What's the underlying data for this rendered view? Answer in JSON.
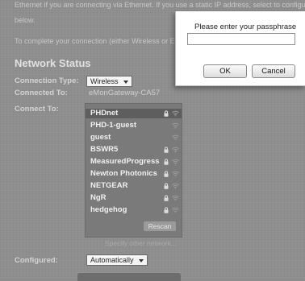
{
  "intro": {
    "line1": "Ethernet if you are connecting via Ethernet. If you use a static IP address, select to configure",
    "line2": "below.",
    "line3": "To complete your connection (either Wireless or E"
  },
  "network_status": {
    "title": "Network Status",
    "connection_type_label": "Connection Type:",
    "connection_type_value": "Wireless",
    "connected_to_label": "Connected To:",
    "connected_to_value": "eMonGateway-CA57",
    "connect_to_label": "Connect To:",
    "networks": [
      {
        "name": "PHDnet",
        "locked": true,
        "selected": true
      },
      {
        "name": "PHD-1-guest",
        "locked": false,
        "selected": false
      },
      {
        "name": "guest",
        "locked": false,
        "selected": false
      },
      {
        "name": "BSWR5",
        "locked": true,
        "selected": false
      },
      {
        "name": "MeasuredProgress",
        "locked": true,
        "selected": false
      },
      {
        "name": "Newton Photonics",
        "locked": true,
        "selected": false
      },
      {
        "name": "NETGEAR",
        "locked": true,
        "selected": false
      },
      {
        "name": "NgR",
        "locked": true,
        "selected": false
      },
      {
        "name": "hedgehog",
        "locked": true,
        "selected": false
      }
    ],
    "rescan_label": "Rescan",
    "specify_other_label": "Specify other network...",
    "configured_label": "Configured:",
    "configured_value": "Automatically"
  },
  "dialog": {
    "prompt": "Please enter your passphrase",
    "passphrase_value": "",
    "ok_label": "OK",
    "cancel_label": "Cancel"
  },
  "colors": {
    "background": "#8e8e8e",
    "selected_row": "#5e5e5e",
    "dialog_bg": "#ffffff"
  }
}
